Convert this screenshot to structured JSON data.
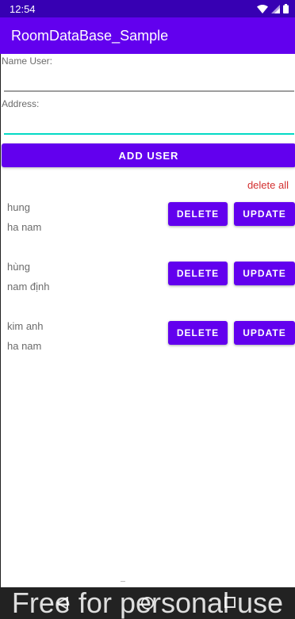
{
  "status_bar": {
    "time": "12:54",
    "icons": [
      "wifi-icon",
      "signal-icon",
      "battery-icon"
    ]
  },
  "app_bar": {
    "title": "RoomDataBase_Sample"
  },
  "form": {
    "name_label": "Name User:",
    "name_value": "",
    "address_label": "Address:",
    "address_value": "",
    "add_button": "ADD USER"
  },
  "list": {
    "delete_all": "delete all",
    "delete_label": "DELETE",
    "update_label": "UPDATE",
    "users": [
      {
        "name": "hung",
        "address": "ha nam"
      },
      {
        "name": "hùng",
        "address": "nam định"
      },
      {
        "name": "kim anh",
        "address": "ha nam"
      }
    ]
  },
  "watermark": "Free for personal use",
  "colors": {
    "primary": "#6200ee",
    "primary_dark": "#3700b3",
    "accent": "#03dac5",
    "delete_all": "#d32f2f"
  }
}
